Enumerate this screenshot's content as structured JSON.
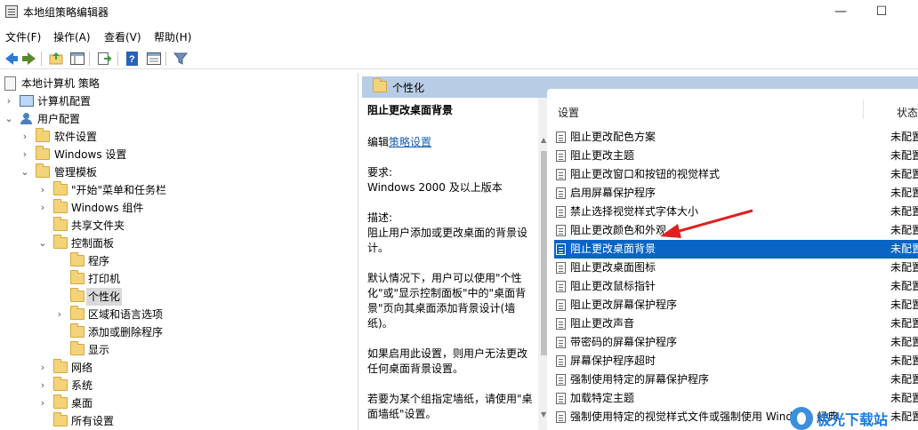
{
  "window": {
    "title": "本地组策略编辑器",
    "minimize": "—",
    "maximize": "☐"
  },
  "menu": [
    "文件(F)",
    "操作(A)",
    "查看(V)",
    "帮助(H)"
  ],
  "toolbar": {
    "icons": [
      "back-icon",
      "forward-icon",
      "up-folder-icon",
      "show-hide-tree-icon",
      "export-list-icon",
      "help-icon",
      "properties-icon",
      "filter-icon"
    ]
  },
  "tree": {
    "root": "本地计算机 策略",
    "computer_config": "计算机配置",
    "user_config": "用户配置",
    "software_settings": "软件设置",
    "windows_settings": "Windows 设置",
    "admin_templates": "管理模板",
    "start_menu": "\"开始\"菜单和任务栏",
    "windows_components": "Windows 组件",
    "shared_folders": "共享文件夹",
    "control_panel": "控制面板",
    "programs": "程序",
    "printers": "打印机",
    "personalization": "个性化",
    "regional": "区域和语言选项",
    "add_remove": "添加或删除程序",
    "display": "显示",
    "network": "网络",
    "system": "系统",
    "desktop": "桌面",
    "all_settings": "所有设置"
  },
  "header": {
    "title": "个性化"
  },
  "description": {
    "policy_title": "阻止更改桌面背景",
    "edit_prefix": "编辑",
    "edit_link": "策略设置",
    "requirements_label": "要求:",
    "requirements": "Windows 2000 及以上版本",
    "desc_label": "描述:",
    "desc_1": "阻止用户添加或更改桌面的背景设计。",
    "desc_2": "默认情况下，用户可以使用\"个性化\"或\"显示控制面板\"中的\"桌面背景\"页向其桌面添加背景设计(墙纸)。",
    "desc_3": "如果启用此设置，则用户无法更改任何桌面背景设置。",
    "desc_4": "若要为某个组指定墙纸，请使用\"桌面墙纸\"设置。"
  },
  "list": {
    "col_setting": "设置",
    "col_state": "状态",
    "rows": [
      {
        "name": "阻止更改配色方案",
        "state": "未配置"
      },
      {
        "name": "阻止更改主题",
        "state": "未配置"
      },
      {
        "name": "阻止更改窗口和按钮的视觉样式",
        "state": "未配置"
      },
      {
        "name": "启用屏幕保护程序",
        "state": "未配置"
      },
      {
        "name": "禁止选择视觉样式字体大小",
        "state": "未配置"
      },
      {
        "name": "阻止更改颜色和外观",
        "state": "未配置"
      },
      {
        "name": "阻止更改桌面背景",
        "state": "未配置"
      },
      {
        "name": "阻止更改桌面图标",
        "state": "未配置"
      },
      {
        "name": "阻止更改鼠标指针",
        "state": "未配置"
      },
      {
        "name": "阻止更改屏幕保护程序",
        "state": "未配置"
      },
      {
        "name": "阻止更改声音",
        "state": "未配置"
      },
      {
        "name": "带密码的屏幕保护程序",
        "state": "未配置"
      },
      {
        "name": "屏幕保护程序超时",
        "state": "未配置"
      },
      {
        "name": "强制使用特定的屏幕保护程序",
        "state": "未配置"
      },
      {
        "name": "加载特定主题",
        "state": "未配置"
      },
      {
        "name": "强制使用特定的视觉样式文件或强制使用 Windows 经典",
        "state": "未配置"
      }
    ]
  },
  "watermark": {
    "text": "极光下载站"
  },
  "colors": {
    "selection": "#0a64c4",
    "header_band": "#b7cde5",
    "annotation_arrow": "#e02020"
  }
}
